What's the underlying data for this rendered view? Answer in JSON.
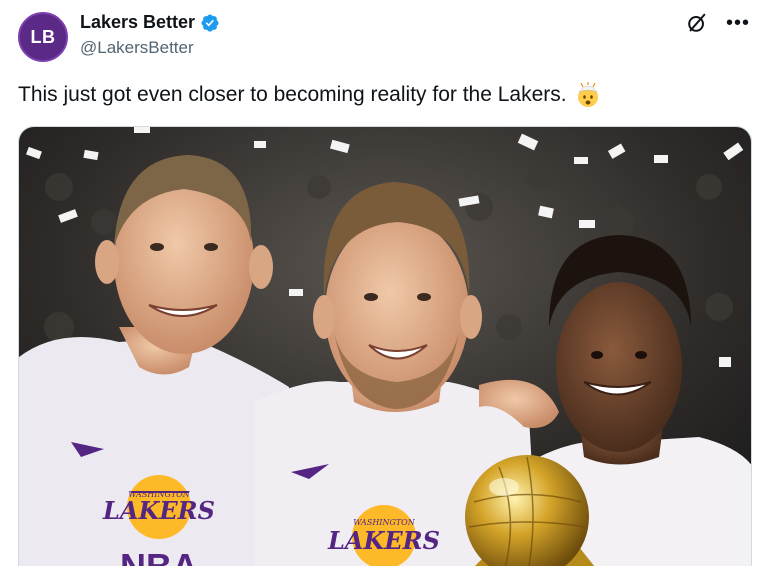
{
  "author": {
    "avatar_text": "LB",
    "display_name": "Lakers Better",
    "handle": "@LakersBetter",
    "verified_icon": "verified-badge-icon"
  },
  "actions": {
    "grok_icon": "grok-icon",
    "more_icon": "more-options-icon"
  },
  "tweet": {
    "text": "This just got even closer to becoming reality for the Lakers.",
    "emoji": "exploding-head-emoji"
  },
  "media": {
    "description_icon": "photo",
    "jersey_logo_text": "LAKERS",
    "jersey_script_text": "WASHINGTON",
    "jersey_extra_text": "NBA"
  },
  "colors": {
    "avatar_bg": "#5b2a86",
    "verified_blue": "#1d9bf0",
    "lakers_purple": "#552583",
    "lakers_gold": "#fdb927"
  }
}
